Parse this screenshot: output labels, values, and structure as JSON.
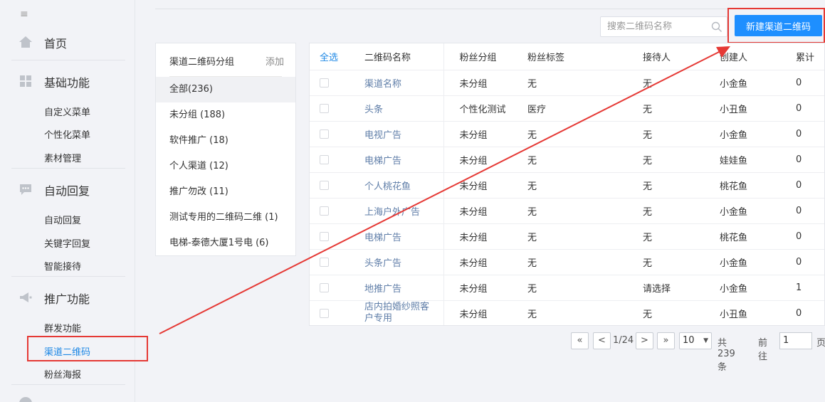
{
  "sidebar": {
    "menu_icon": "≡",
    "home": "首页",
    "sections": [
      {
        "title": "基础功能",
        "items": [
          "自定义菜单",
          "个性化菜单",
          "素材管理"
        ]
      },
      {
        "title": "自动回复",
        "items": [
          "自动回复",
          "关键字回复",
          "智能接待"
        ]
      },
      {
        "title": "推广功能",
        "items": [
          "群发功能",
          "渠道二维码",
          "粉丝海报"
        ]
      }
    ],
    "active_item": "渠道二维码"
  },
  "toolbar": {
    "search_placeholder": "搜索二维码名称",
    "new_button": "新建渠道二维码"
  },
  "groups": {
    "title": "渠道二维码分组",
    "add": "添加",
    "items": [
      "全部(236)",
      "未分组 (188)",
      "软件推广 (18)",
      "个人渠道 (12)",
      "推广勿改 (11)",
      "测试专用的二维码二维 (1)",
      "电梯-泰德大厦1号电 (6)"
    ]
  },
  "table": {
    "headers": [
      "全选",
      "二维码名称",
      "粉丝分组",
      "粉丝标签",
      "接待人",
      "创建人",
      "累计"
    ],
    "rows": [
      [
        "渠道名称",
        "未分组",
        "无",
        "无",
        "小金鱼",
        "0"
      ],
      [
        "头条",
        "个性化测试",
        "医疗",
        "无",
        "小丑鱼",
        "0"
      ],
      [
        "电视广告",
        "未分组",
        "无",
        "无",
        "小金鱼",
        "0"
      ],
      [
        "电梯广告",
        "未分组",
        "无",
        "无",
        "娃娃鱼",
        "0"
      ],
      [
        "个人桃花鱼",
        "未分组",
        "无",
        "无",
        "桃花鱼",
        "0"
      ],
      [
        "上海户外广告",
        "未分组",
        "无",
        "无",
        "小金鱼",
        "0"
      ],
      [
        "电梯广告",
        "未分组",
        "无",
        "无",
        "桃花鱼",
        "0"
      ],
      [
        "头条广告",
        "未分组",
        "无",
        "无",
        "小金鱼",
        "0"
      ],
      [
        "地推广告",
        "未分组",
        "无",
        "请选择",
        "小金鱼",
        "1"
      ],
      [
        "店内拍婚纱照客户专用",
        "未分组",
        "无",
        "无",
        "小丑鱼",
        "0"
      ]
    ]
  },
  "pager": {
    "first": "«",
    "prev": "<",
    "page": "1/24",
    "next": ">",
    "last": "»",
    "page_size": "10",
    "total": "共239条",
    "goto_label": "前往",
    "goto_value": "1",
    "page_unit": "页"
  },
  "colors": {
    "primary": "#1e8fff",
    "annotation": "#e53935",
    "link": "#5f7ea8"
  }
}
